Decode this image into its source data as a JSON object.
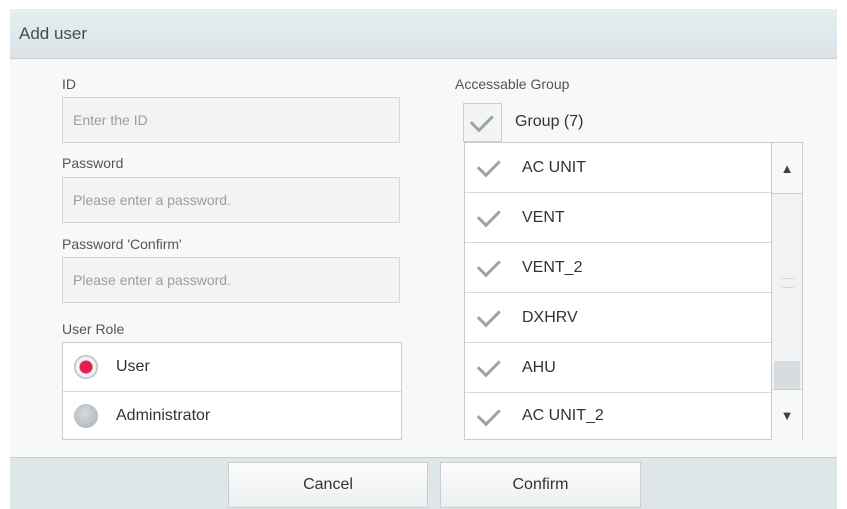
{
  "dialog": {
    "title": "Add user"
  },
  "form": {
    "id_label": "ID",
    "id_placeholder": "Enter the ID",
    "id_value": "",
    "password_label": "Password",
    "password_placeholder": "Please enter a password.",
    "password_value": "",
    "confirm_label": "Password 'Confirm'",
    "confirm_placeholder": "Please enter a password.",
    "confirm_value": ""
  },
  "role": {
    "label": "User Role",
    "options": [
      {
        "label": "User",
        "selected": true
      },
      {
        "label": "Administrator",
        "selected": false
      }
    ]
  },
  "groups": {
    "label": "Accessable Group",
    "header": "Group (7)",
    "items": [
      {
        "label": "AC UNIT",
        "checked": true
      },
      {
        "label": "VENT",
        "checked": true
      },
      {
        "label": "VENT_2",
        "checked": true
      },
      {
        "label": "DXHRV",
        "checked": true
      },
      {
        "label": "AHU",
        "checked": true
      },
      {
        "label": "AC UNIT_2",
        "checked": true
      }
    ],
    "scroll_up": "▲",
    "scroll_down": "▼"
  },
  "buttons": {
    "cancel": "Cancel",
    "confirm": "Confirm"
  },
  "colors": {
    "accent": "#e0204f",
    "check": "#9da3a7"
  }
}
